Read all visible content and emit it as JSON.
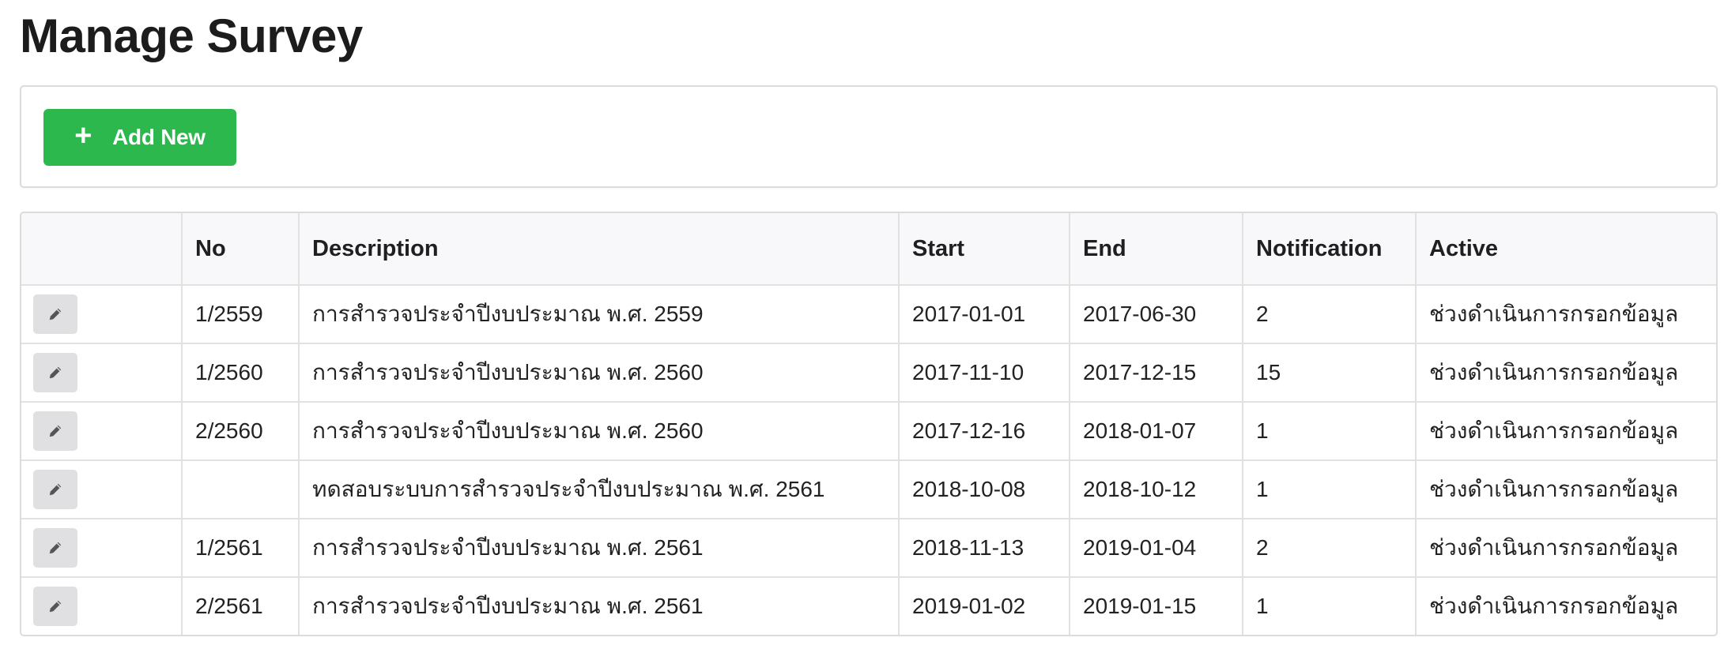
{
  "page": {
    "title": "Manage Survey"
  },
  "toolbar": {
    "add_label": "Add New",
    "add_icon": "plus-icon",
    "add_color": "#2db84d"
  },
  "table": {
    "columns": [
      "",
      "No",
      "Description",
      "Start",
      "End",
      "Notification",
      "Active"
    ],
    "rows": [
      {
        "no": "1/2559",
        "description": "การสำรวจประจำปีงบประมาณ พ.ศ. 2559",
        "start": "2017-01-01",
        "end": "2017-06-30",
        "notification": "2",
        "active": "ช่วงดำเนินการกรอกข้อมูล"
      },
      {
        "no": "1/2560",
        "description": "การสำรวจประจำปีงบประมาณ พ.ศ. 2560",
        "start": "2017-11-10",
        "end": "2017-12-15",
        "notification": "15",
        "active": "ช่วงดำเนินการกรอกข้อมูล"
      },
      {
        "no": "2/2560",
        "description": "การสำรวจประจำปีงบประมาณ พ.ศ. 2560",
        "start": "2017-12-16",
        "end": "2018-01-07",
        "notification": "1",
        "active": "ช่วงดำเนินการกรอกข้อมูล"
      },
      {
        "no": "",
        "description": "ทดสอบระบบการสำรวจประจำปีงบประมาณ พ.ศ. 2561",
        "start": "2018-10-08",
        "end": "2018-10-12",
        "notification": "1",
        "active": "ช่วงดำเนินการกรอกข้อมูล"
      },
      {
        "no": "1/2561",
        "description": "การสำรวจประจำปีงบประมาณ พ.ศ. 2561",
        "start": "2018-11-13",
        "end": "2019-01-04",
        "notification": "2",
        "active": "ช่วงดำเนินการกรอกข้อมูล"
      },
      {
        "no": "2/2561",
        "description": "การสำรวจประจำปีงบประมาณ พ.ศ. 2561",
        "start": "2019-01-02",
        "end": "2019-01-15",
        "notification": "1",
        "active": "ช่วงดำเนินการกรอกข้อมูล"
      }
    ],
    "row_action_icon": "pencil-icon"
  }
}
